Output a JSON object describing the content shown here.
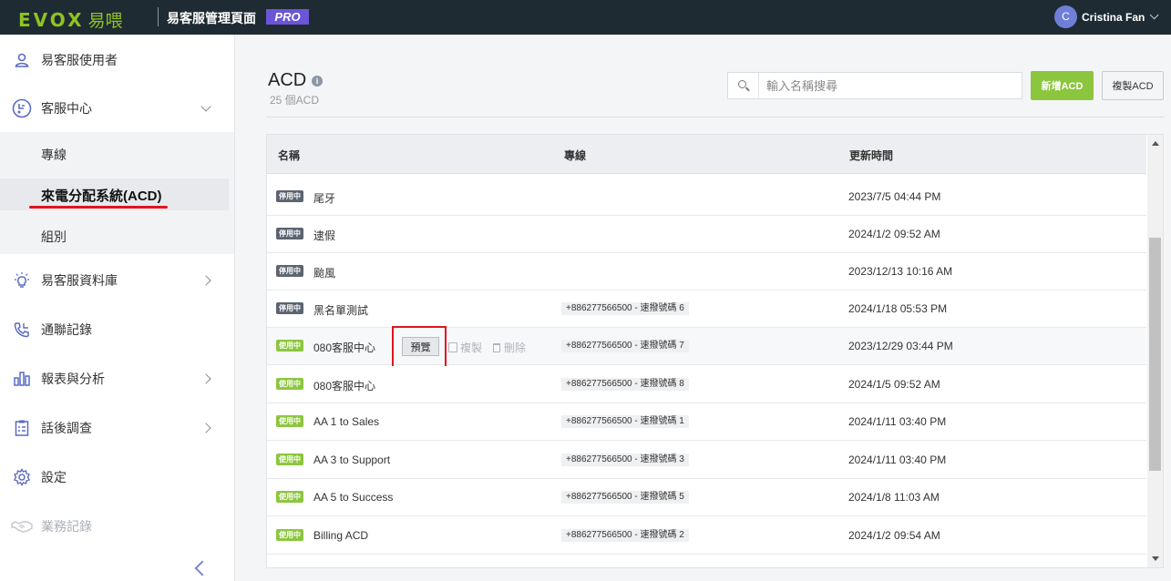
{
  "topbar": {
    "logo_text": "EVOX",
    "logo_cn": "易喂",
    "app_title": "易客服管理頁面",
    "pro_badge": "PRO",
    "user_initial": "C",
    "user_name": "Cristina Fan"
  },
  "sidebar": {
    "items": [
      {
        "label": "易客服使用者",
        "icon": "user-icon"
      },
      {
        "label": "客服中心",
        "icon": "service-center-icon"
      },
      {
        "label": "易客服資料庫",
        "icon": "lightbulb-icon"
      },
      {
        "label": "通聯記錄",
        "icon": "phone-icon"
      },
      {
        "label": "報表與分析",
        "icon": "chart-icon"
      },
      {
        "label": "話後調查",
        "icon": "clipboard-icon"
      },
      {
        "label": "設定",
        "icon": "gear-icon"
      },
      {
        "label": "業務記錄",
        "icon": "handshake-icon"
      }
    ],
    "sub_items": [
      {
        "label": "專線"
      },
      {
        "label": "來電分配系統(ACD)"
      },
      {
        "label": "組別"
      }
    ]
  },
  "main": {
    "title": "ACD",
    "count": "25 個ACD",
    "search_placeholder": "輸入名稱搜尋",
    "new_button": "新增ACD",
    "copy_button": "複製ACD",
    "table": {
      "headers": [
        "名稱",
        "專線",
        "更新時間"
      ],
      "rows": [
        {
          "status": "停用中",
          "status_type": "off",
          "name": "尾牙",
          "line": "",
          "time": "2023/7/5 04:44 PM"
        },
        {
          "status": "停用中",
          "status_type": "off",
          "name": "逮假",
          "line": "",
          "time": "2024/1/2 09:52 AM"
        },
        {
          "status": "停用中",
          "status_type": "off",
          "name": "颱風",
          "line": "",
          "time": "2023/12/13 10:16 AM"
        },
        {
          "status": "停用中",
          "status_type": "off",
          "name": "黑名單測試",
          "line": "+886277566500 - 速撥號碼 6",
          "time": "2024/1/18 05:53 PM"
        },
        {
          "status": "使用中",
          "status_type": "on",
          "name": "080客服中心",
          "line": "+886277566500 - 速撥號碼 7",
          "time": "2023/12/29 03:44 PM"
        },
        {
          "status": "使用中",
          "status_type": "on",
          "name": "080客服中心",
          "line": "+886277566500 - 速撥號碼 8",
          "time": "2024/1/5 09:52 AM"
        },
        {
          "status": "使用中",
          "status_type": "on",
          "name": "AA 1 to Sales",
          "line": "+886277566500 - 速撥號碼 1",
          "time": "2024/1/11 03:40 PM"
        },
        {
          "status": "使用中",
          "status_type": "on",
          "name": "AA 3 to Support",
          "line": "+886277566500 - 速撥號碼 3",
          "time": "2024/1/11 03:40 PM"
        },
        {
          "status": "使用中",
          "status_type": "on",
          "name": "AA 5 to Success",
          "line": "+886277566500 - 速撥號碼 5",
          "time": "2024/1/8 11:03 AM"
        },
        {
          "status": "使用中",
          "status_type": "on",
          "name": "Billing ACD",
          "line": "+886277566500 - 速撥號碼 2",
          "time": "2024/1/2 09:54 AM"
        }
      ]
    },
    "row_actions": {
      "preview": "預覽",
      "copy": "複製",
      "delete": "刪除"
    }
  },
  "colors": {
    "topbar": "#1f2b33",
    "brand_green": "#8cc63f",
    "pro_purple": "#6b55d6",
    "highlight_red": "#e0141e"
  }
}
